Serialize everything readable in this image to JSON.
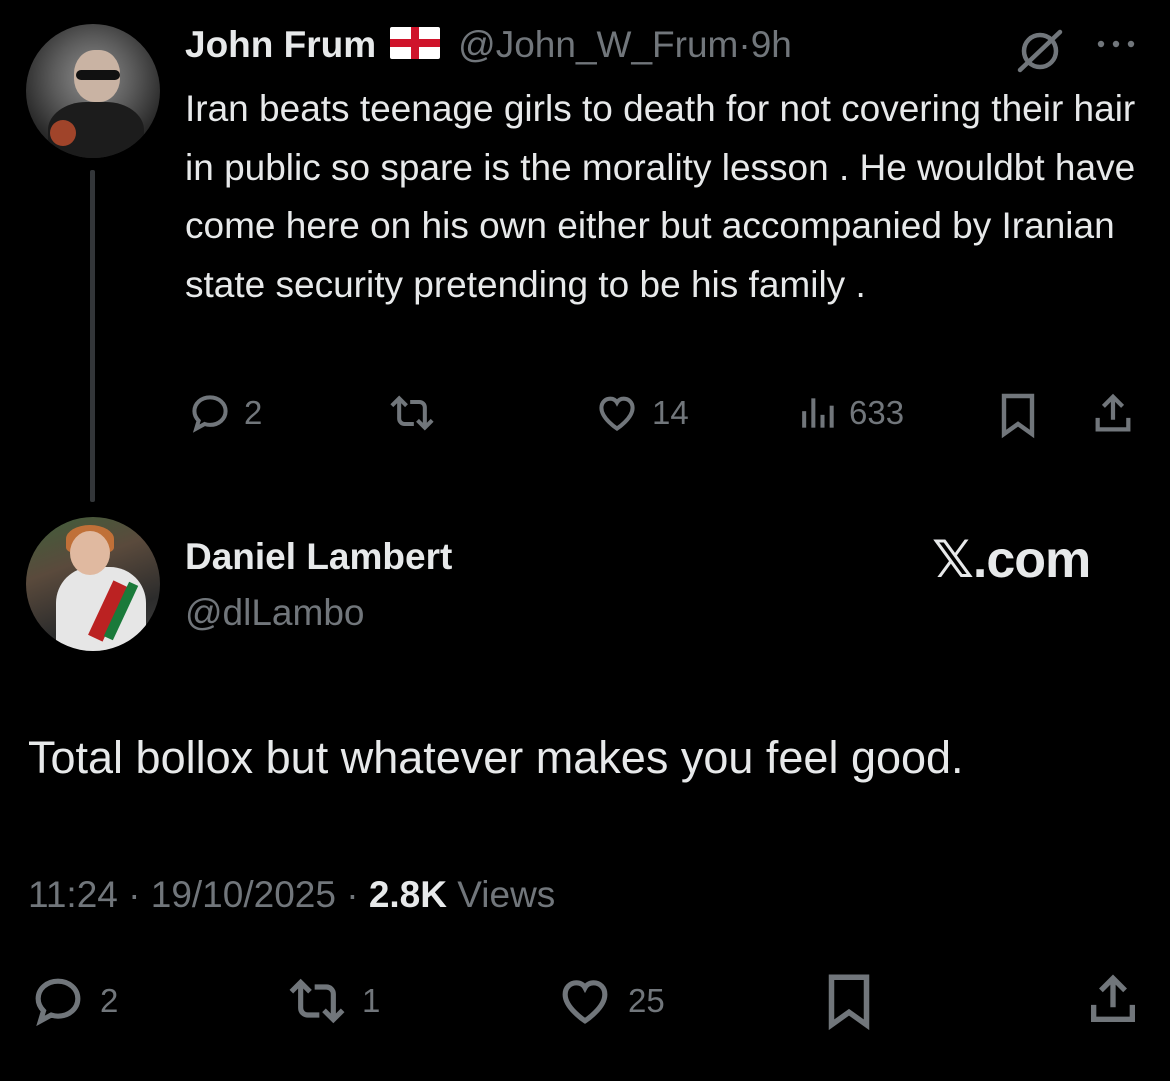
{
  "parent_tweet": {
    "author_name": "John Frum",
    "handle": "@John_W_Frum",
    "separator": "·",
    "time_ago": "9h",
    "text": "Iran beats teenage girls to death for not covering their hair in public so spare is the morality lesson . He wouldbt have come here on his own either but accompanied by Iranian state security pretending to be his family .",
    "replies": "2",
    "likes": "14",
    "views": "633",
    "icons": [
      "england-flag-icon",
      "grok-icon",
      "more-icon",
      "reply-icon",
      "retweet-icon",
      "like-icon",
      "views-icon",
      "bookmark-icon",
      "share-icon"
    ]
  },
  "main_tweet": {
    "author_name": "Daniel Lambert",
    "handle": "@dlLambo",
    "watermark": "𝕏.com",
    "text": "Total bollox but whatever makes you feel good.",
    "time": "11:24",
    "date": "19/10/2025",
    "separator": "·",
    "views_count": "2.8K",
    "views_label": "Views",
    "replies": "2",
    "reposts": "1",
    "likes": "25",
    "icons": [
      "reply-icon",
      "retweet-icon",
      "like-icon",
      "bookmark-icon",
      "share-icon"
    ]
  },
  "colors": {
    "background": "#000000",
    "text": "#e7e9ea",
    "muted": "#71767b",
    "thread_line": "#333639"
  }
}
